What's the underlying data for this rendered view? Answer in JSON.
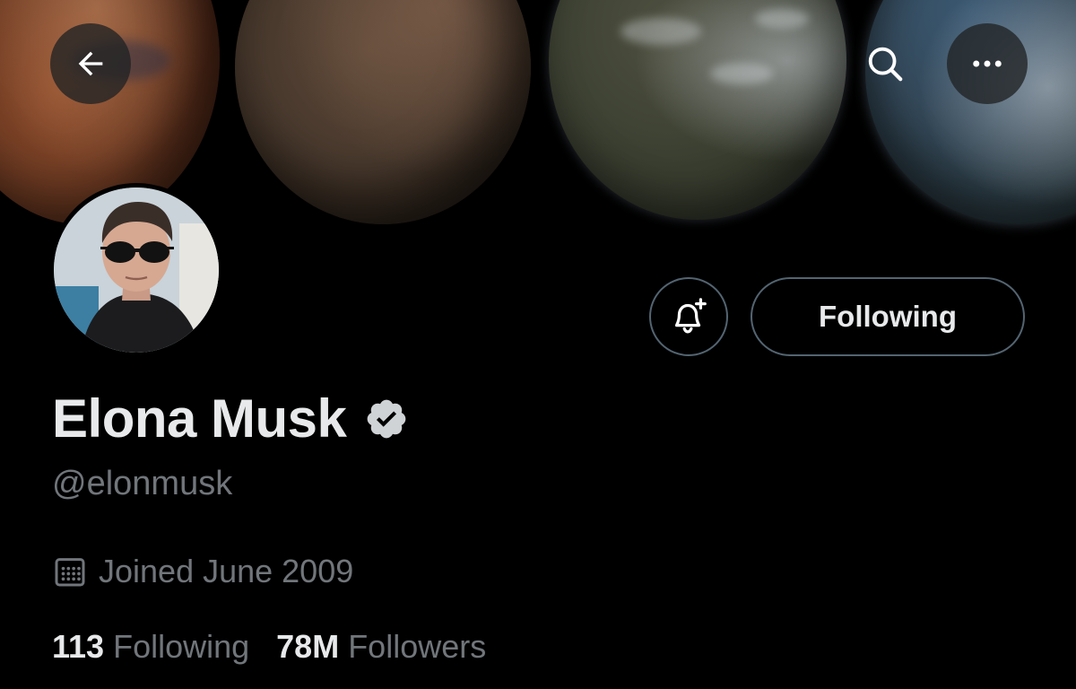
{
  "header": {
    "back_icon": "arrow-left-icon",
    "search_icon": "search-icon",
    "more_icon": "more-horizontal-icon"
  },
  "profile": {
    "display_name": "Elona Musk",
    "handle": "@elonmusk",
    "verified": true,
    "joined": "Joined June 2009",
    "following_count": "113",
    "following_label": "Following",
    "followers_count": "78M",
    "followers_label": "Followers"
  },
  "actions": {
    "notify_icon": "bell-plus-icon",
    "following_button_label": "Following"
  },
  "colors": {
    "background": "#000000",
    "primary_text": "#e7e9ea",
    "secondary_text": "#71767b",
    "border": "#536471"
  }
}
